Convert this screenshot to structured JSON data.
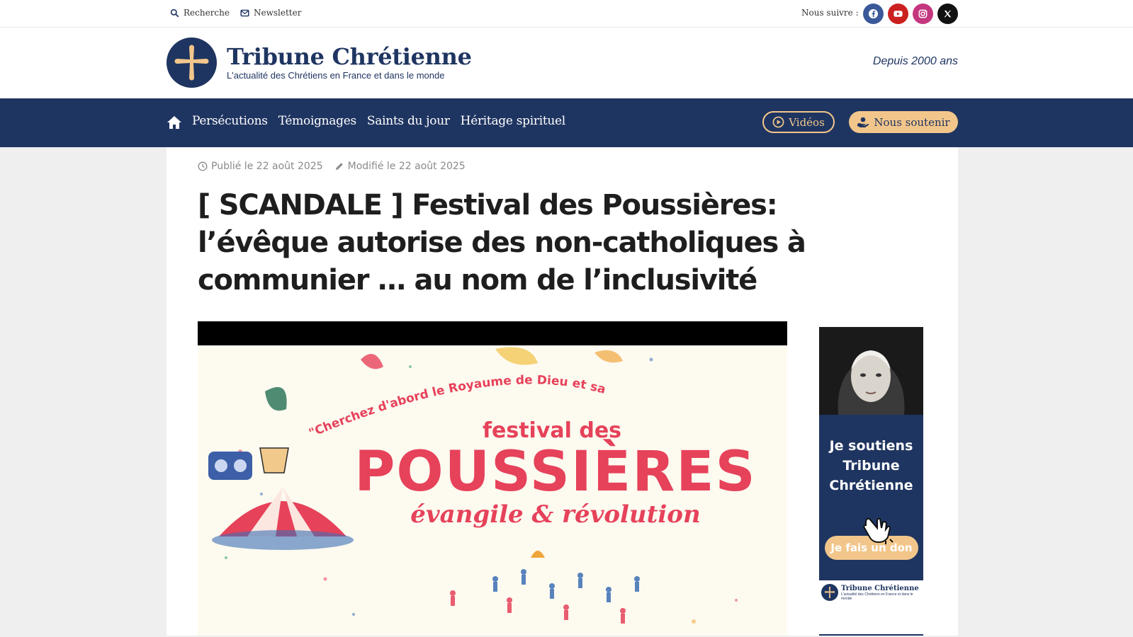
{
  "topbar": {
    "search_label": "Recherche",
    "newsletter_label": "Newsletter",
    "follow_label": "Nous suivre :",
    "social": [
      {
        "name": "facebook",
        "color": "#3b5998"
      },
      {
        "name": "youtube",
        "color": "#cc1f1f"
      },
      {
        "name": "instagram",
        "color": "#c4377f"
      },
      {
        "name": "x",
        "color": "#111111"
      }
    ]
  },
  "header": {
    "brand_title": "Tribune Chrétienne",
    "brand_tagline": "L'actualité des Chrétiens en France et dans le monde",
    "since": "Depuis 2000 ans"
  },
  "nav": {
    "items": [
      "Persécutions",
      "Témoignages",
      "Saints du jour",
      "Héritage spirituel"
    ],
    "videos_label": "Vidéos",
    "support_label": "Nous soutenir"
  },
  "article": {
    "published": "Publié le 22 août 2025",
    "modified": "Modifié le 22 août 2025",
    "headline": "[ SCANDALE ] Festival des Poussières: l’évêque autorise des non-catholiques à communier … au nom de l’inclusivité",
    "hero": {
      "quote": "\"Cherchez d'abord le Royaume de Dieu et sa justice\"",
      "festival_small": "festival des",
      "festival_big": "POUSSIÈRES",
      "festival_sub": "évangile & révolution"
    }
  },
  "ad": {
    "text_lines": [
      "Je soutiens",
      "Tribune",
      "Chrétienne"
    ],
    "button": "Je fais un don",
    "footer_title": "Tribune Chrétienne",
    "footer_tagline": "L'actualité des Chrétiens en France et dans le monde"
  },
  "colors": {
    "brand_navy": "#1f3561",
    "accent_gold": "#f2c68b",
    "festival_red": "#e6425a"
  }
}
